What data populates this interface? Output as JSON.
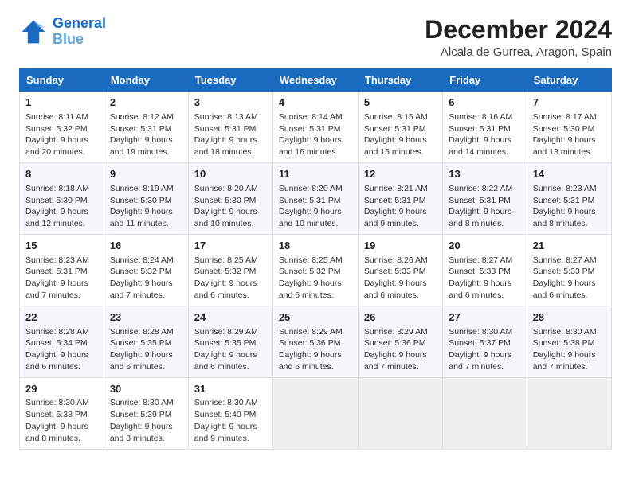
{
  "logo": {
    "line1": "General",
    "line2": "Blue"
  },
  "title": "December 2024",
  "location": "Alcala de Gurrea, Aragon, Spain",
  "columns": [
    "Sunday",
    "Monday",
    "Tuesday",
    "Wednesday",
    "Thursday",
    "Friday",
    "Saturday"
  ],
  "weeks": [
    [
      {
        "day": "1",
        "sunrise": "8:11 AM",
        "sunset": "5:32 PM",
        "daylight": "9 hours and 20 minutes."
      },
      {
        "day": "2",
        "sunrise": "8:12 AM",
        "sunset": "5:31 PM",
        "daylight": "9 hours and 19 minutes."
      },
      {
        "day": "3",
        "sunrise": "8:13 AM",
        "sunset": "5:31 PM",
        "daylight": "9 hours and 18 minutes."
      },
      {
        "day": "4",
        "sunrise": "8:14 AM",
        "sunset": "5:31 PM",
        "daylight": "9 hours and 16 minutes."
      },
      {
        "day": "5",
        "sunrise": "8:15 AM",
        "sunset": "5:31 PM",
        "daylight": "9 hours and 15 minutes."
      },
      {
        "day": "6",
        "sunrise": "8:16 AM",
        "sunset": "5:31 PM",
        "daylight": "9 hours and 14 minutes."
      },
      {
        "day": "7",
        "sunrise": "8:17 AM",
        "sunset": "5:30 PM",
        "daylight": "9 hours and 13 minutes."
      }
    ],
    [
      {
        "day": "8",
        "sunrise": "8:18 AM",
        "sunset": "5:30 PM",
        "daylight": "9 hours and 12 minutes."
      },
      {
        "day": "9",
        "sunrise": "8:19 AM",
        "sunset": "5:30 PM",
        "daylight": "9 hours and 11 minutes."
      },
      {
        "day": "10",
        "sunrise": "8:20 AM",
        "sunset": "5:30 PM",
        "daylight": "9 hours and 10 minutes."
      },
      {
        "day": "11",
        "sunrise": "8:20 AM",
        "sunset": "5:31 PM",
        "daylight": "9 hours and 10 minutes."
      },
      {
        "day": "12",
        "sunrise": "8:21 AM",
        "sunset": "5:31 PM",
        "daylight": "9 hours and 9 minutes."
      },
      {
        "day": "13",
        "sunrise": "8:22 AM",
        "sunset": "5:31 PM",
        "daylight": "9 hours and 8 minutes."
      },
      {
        "day": "14",
        "sunrise": "8:23 AM",
        "sunset": "5:31 PM",
        "daylight": "9 hours and 8 minutes."
      }
    ],
    [
      {
        "day": "15",
        "sunrise": "8:23 AM",
        "sunset": "5:31 PM",
        "daylight": "9 hours and 7 minutes."
      },
      {
        "day": "16",
        "sunrise": "8:24 AM",
        "sunset": "5:32 PM",
        "daylight": "9 hours and 7 minutes."
      },
      {
        "day": "17",
        "sunrise": "8:25 AM",
        "sunset": "5:32 PM",
        "daylight": "9 hours and 6 minutes."
      },
      {
        "day": "18",
        "sunrise": "8:25 AM",
        "sunset": "5:32 PM",
        "daylight": "9 hours and 6 minutes."
      },
      {
        "day": "19",
        "sunrise": "8:26 AM",
        "sunset": "5:33 PM",
        "daylight": "9 hours and 6 minutes."
      },
      {
        "day": "20",
        "sunrise": "8:27 AM",
        "sunset": "5:33 PM",
        "daylight": "9 hours and 6 minutes."
      },
      {
        "day": "21",
        "sunrise": "8:27 AM",
        "sunset": "5:33 PM",
        "daylight": "9 hours and 6 minutes."
      }
    ],
    [
      {
        "day": "22",
        "sunrise": "8:28 AM",
        "sunset": "5:34 PM",
        "daylight": "9 hours and 6 minutes."
      },
      {
        "day": "23",
        "sunrise": "8:28 AM",
        "sunset": "5:35 PM",
        "daylight": "9 hours and 6 minutes."
      },
      {
        "day": "24",
        "sunrise": "8:29 AM",
        "sunset": "5:35 PM",
        "daylight": "9 hours and 6 minutes."
      },
      {
        "day": "25",
        "sunrise": "8:29 AM",
        "sunset": "5:36 PM",
        "daylight": "9 hours and 6 minutes."
      },
      {
        "day": "26",
        "sunrise": "8:29 AM",
        "sunset": "5:36 PM",
        "daylight": "9 hours and 7 minutes."
      },
      {
        "day": "27",
        "sunrise": "8:30 AM",
        "sunset": "5:37 PM",
        "daylight": "9 hours and 7 minutes."
      },
      {
        "day": "28",
        "sunrise": "8:30 AM",
        "sunset": "5:38 PM",
        "daylight": "9 hours and 7 minutes."
      }
    ],
    [
      {
        "day": "29",
        "sunrise": "8:30 AM",
        "sunset": "5:38 PM",
        "daylight": "9 hours and 8 minutes."
      },
      {
        "day": "30",
        "sunrise": "8:30 AM",
        "sunset": "5:39 PM",
        "daylight": "9 hours and 8 minutes."
      },
      {
        "day": "31",
        "sunrise": "8:30 AM",
        "sunset": "5:40 PM",
        "daylight": "9 hours and 9 minutes."
      },
      null,
      null,
      null,
      null
    ]
  ]
}
